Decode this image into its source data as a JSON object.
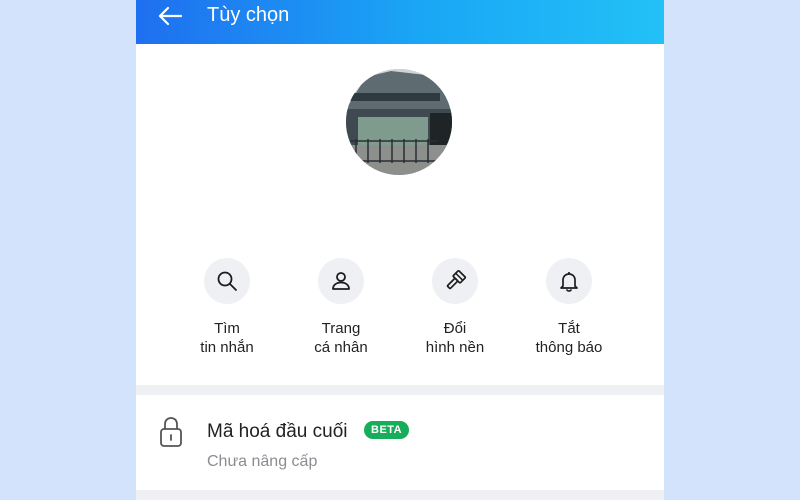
{
  "header": {
    "title": "Tùy chọn",
    "back_icon": "arrow-left-icon"
  },
  "avatar": {
    "description": "group-photo"
  },
  "actions": [
    {
      "line1": "Tìm",
      "line2": "tin nhắn",
      "icon": "search-icon"
    },
    {
      "line1": "Trang",
      "line2": "cá nhân",
      "icon": "person-icon"
    },
    {
      "line1": "Đổi",
      "line2": "hình nền",
      "icon": "paintbrush-icon"
    },
    {
      "line1": "Tắt",
      "line2": "thông báo",
      "icon": "bell-icon"
    }
  ],
  "e2e": {
    "title": "Mã hoá đầu cuối",
    "badge": "BETA",
    "subtitle": "Chưa nâng cấp",
    "icon": "lock-icon"
  },
  "colors": {
    "page_bg": "#d3e3fb",
    "header_start": "#1f6ff0",
    "header_end": "#22c1f7",
    "badge_green": "#17ad5a"
  }
}
